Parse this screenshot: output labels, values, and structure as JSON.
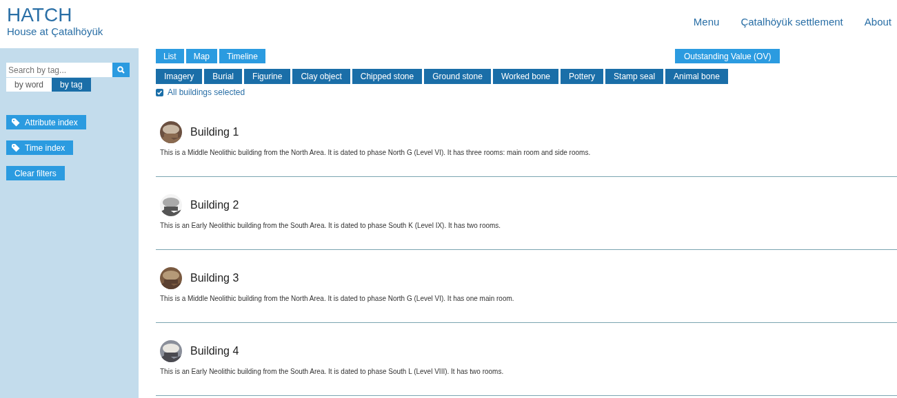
{
  "header": {
    "title": "HATCH",
    "subtitle": "House at Çatalhöyük",
    "nav": [
      "Menu",
      "Çatalhöyük settlement",
      "About"
    ]
  },
  "sidebar": {
    "search": {
      "placeholder": "Search by tag..."
    },
    "modes": [
      {
        "label": "by word",
        "selected": false
      },
      {
        "label": "by tag",
        "selected": true
      }
    ],
    "buttons": [
      {
        "label": "Attribute index",
        "kind": "tag"
      },
      {
        "label": "Time index",
        "kind": "tag"
      },
      {
        "label": "Clear filters",
        "kind": "plain"
      }
    ]
  },
  "views": [
    "List",
    "Map",
    "Timeline"
  ],
  "ov_button": "Outstanding Value (OV)",
  "categories": [
    "Imagery",
    "Burial",
    "Figurine",
    "Clay object",
    "Chipped stone",
    "Ground stone",
    "Worked bone",
    "Pottery",
    "Stamp seal",
    "Animal bone"
  ],
  "all_selected": {
    "label": "All buildings selected",
    "checked": true
  },
  "buildings": [
    {
      "title": "Building 1",
      "text": "This is a Middle Neolithic building from the North Area. It is dated to phase North G (Level VI). It has three rooms: main room and side rooms."
    },
    {
      "title": "Building 2",
      "text": "This is an Early Neolithic building from the South Area. It is dated to phase South K (Level IX). It has two rooms."
    },
    {
      "title": "Building 3",
      "text": "This is a Middle Neolithic building from the North Area. It is dated to phase North G (Level VI). It has one main room."
    },
    {
      "title": "Building 4",
      "text": "This is an Early Neolithic building from the South Area. It is dated to phase South L (Level VIII). It has two rooms."
    }
  ]
}
